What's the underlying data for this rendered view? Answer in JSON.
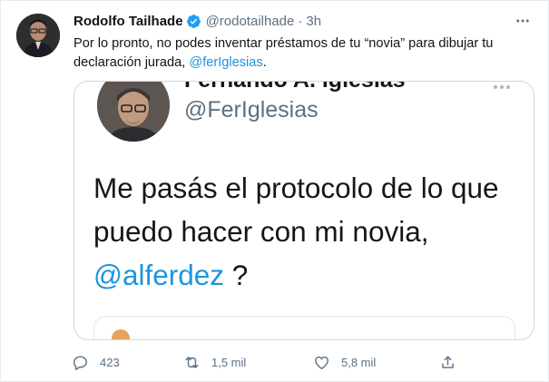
{
  "tweet": {
    "author_name": "Rodolfo Tailhade",
    "author_handle": "@rodotailhade",
    "separator": "·",
    "time": "3h",
    "text_prefix": "Por lo pronto, no podes inventar préstamos de tu “novia” para dibujar tu declaración jurada, ",
    "mention": "@ferIglesias",
    "text_suffix": "."
  },
  "media": {
    "author_name": "Fernando A. Iglesias",
    "author_handle": "@FerIglesias",
    "text": "Me pasás el protocolo de lo que puedo hacer con mi novia,",
    "mention": "@alferdez",
    "text_end": " ?"
  },
  "actions": {
    "reply_count": "423",
    "retweet_count": "1,5 mil",
    "like_count": "5,8 mil"
  },
  "colors": {
    "accent": "#1b95e0",
    "muted": "#5b7083",
    "verified": "#1da1f2"
  },
  "icons": [
    "verified-badge-icon",
    "more-options-icon",
    "reply-icon",
    "retweet-icon",
    "like-icon",
    "share-icon"
  ]
}
